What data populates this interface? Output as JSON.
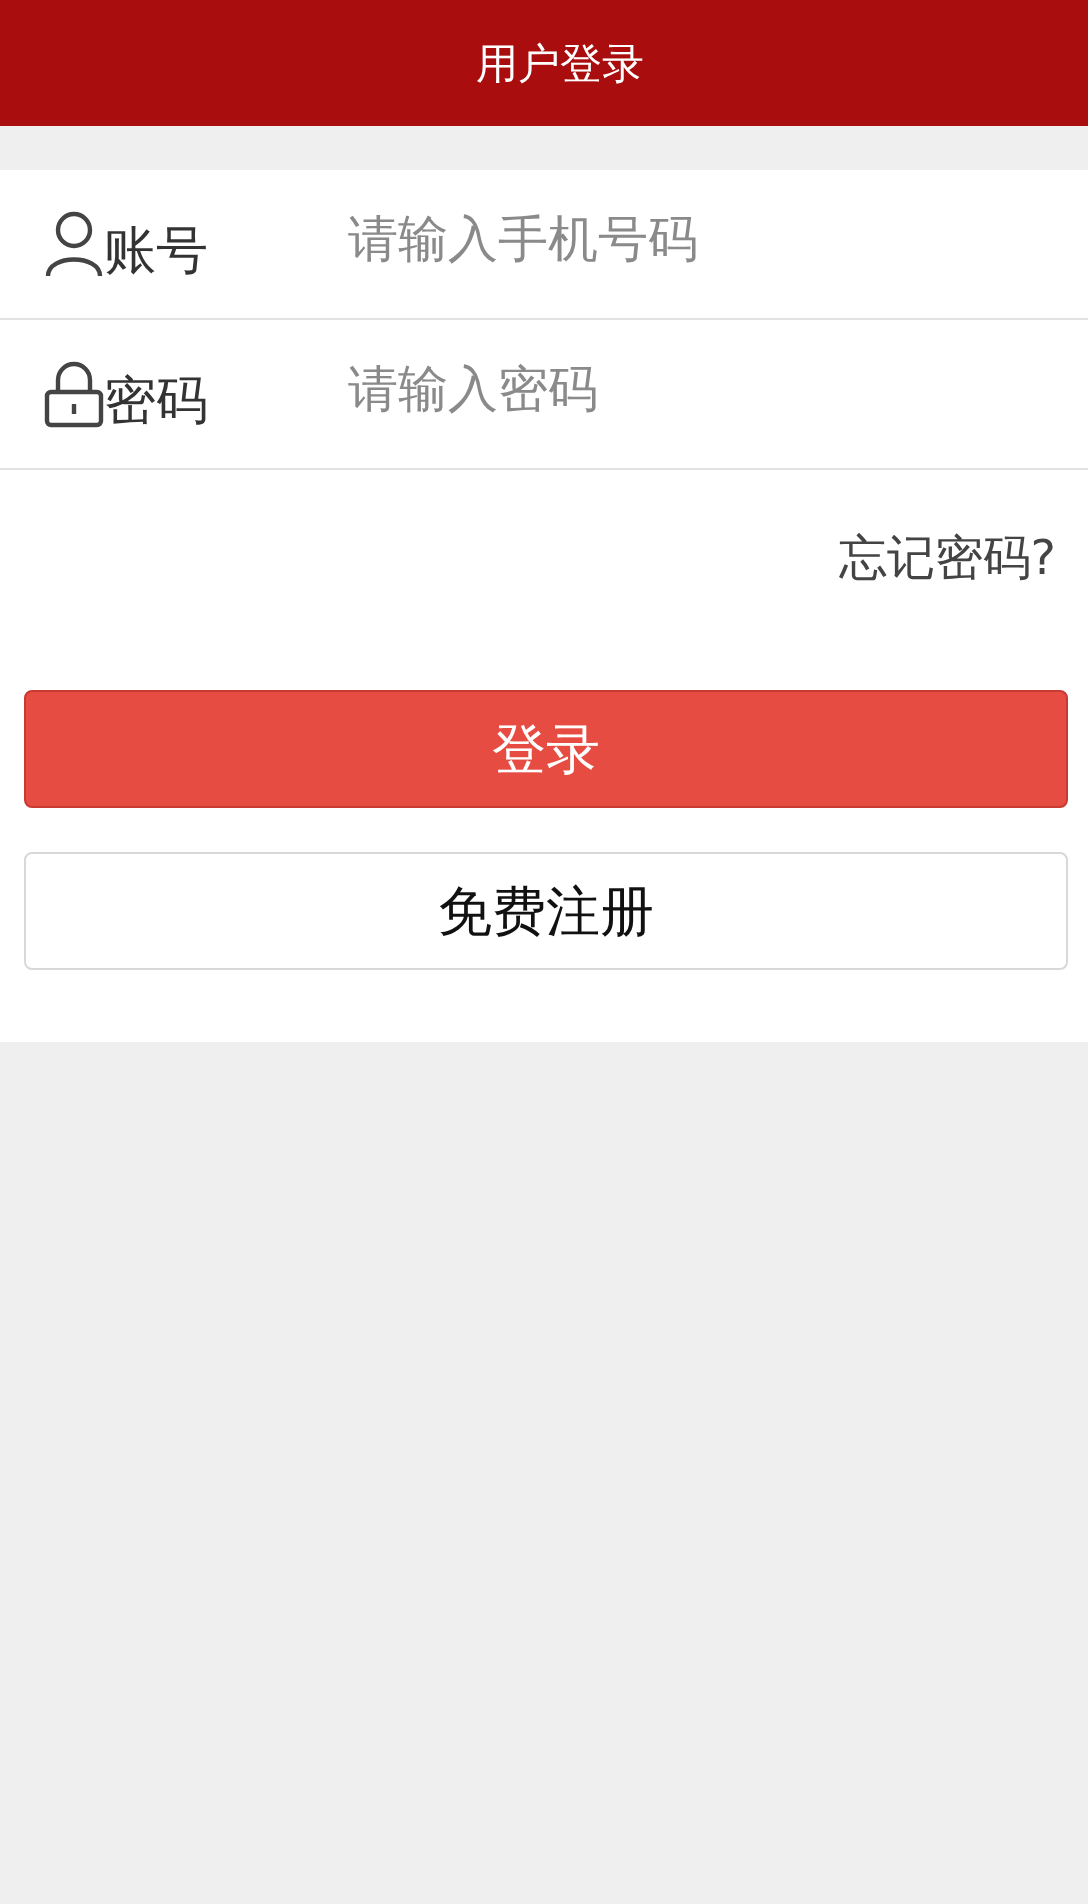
{
  "header": {
    "title": "用户登录"
  },
  "fields": [
    {
      "kind": "account",
      "label": "账号",
      "placeholder": "请输入手机号码"
    },
    {
      "kind": "password",
      "label": "密码",
      "placeholder": "请输入密码"
    }
  ],
  "forgot_link": "忘记密码?",
  "buttons": [
    {
      "kind": "primary",
      "label": "登录"
    },
    {
      "kind": "secondary",
      "label": "免费注册"
    }
  ]
}
